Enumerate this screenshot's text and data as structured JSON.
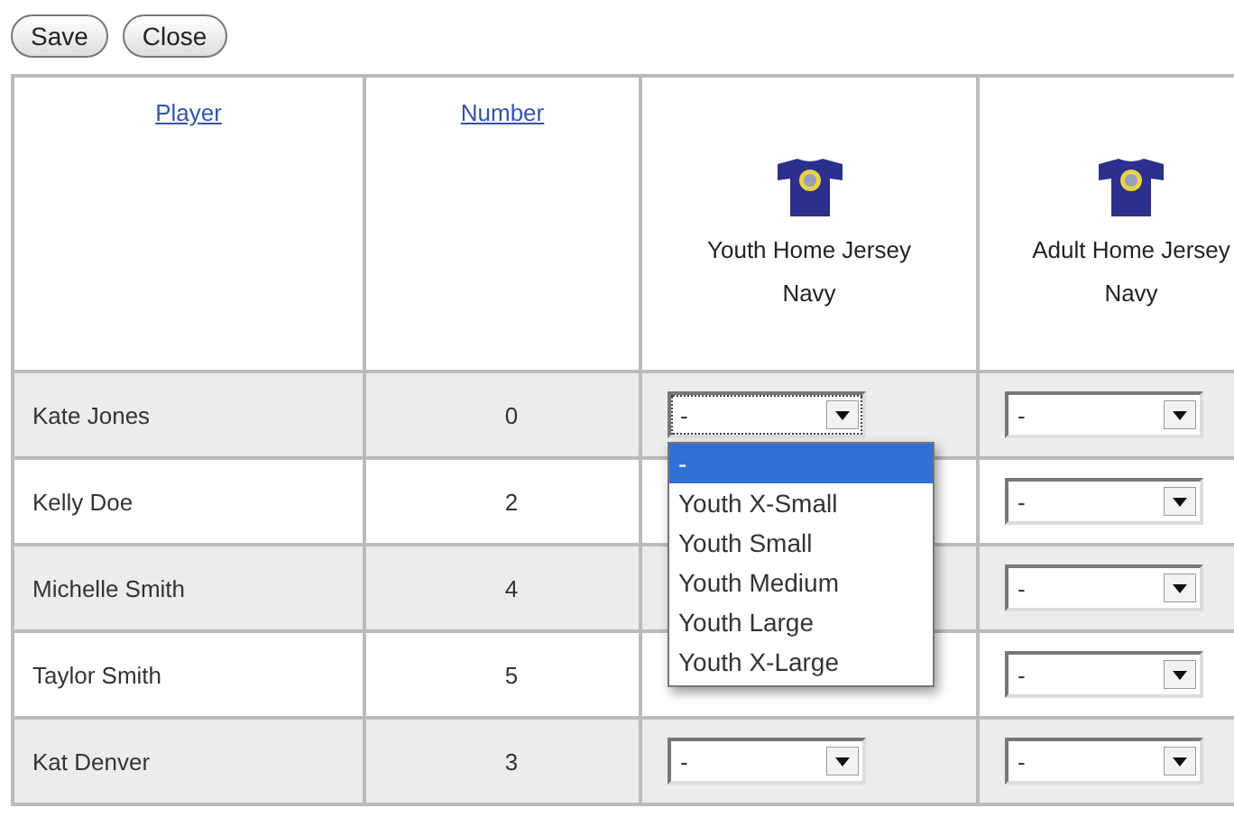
{
  "toolbar": {
    "buttons": [
      "Save",
      "Close"
    ]
  },
  "table": {
    "columns": [
      {
        "kind": "link",
        "label": "Player"
      },
      {
        "kind": "link",
        "label": "Number"
      },
      {
        "kind": "jersey",
        "label": "Youth Home Jersey Navy"
      },
      {
        "kind": "jersey",
        "label": "Adult Home Jersey Navy"
      }
    ],
    "rows": [
      {
        "player": "Kate Jones",
        "number": "0",
        "youth": {
          "value": "-",
          "focused": true,
          "open": true,
          "options": [
            {
              "label": "-",
              "selected": true
            },
            {
              "label": "Youth X-Small",
              "selected": false
            },
            {
              "label": "Youth Small",
              "selected": false
            },
            {
              "label": "Youth Medium",
              "selected": false
            },
            {
              "label": "Youth Large",
              "selected": false
            },
            {
              "label": "Youth X-Large",
              "selected": false
            }
          ]
        },
        "adult": {
          "value": "-",
          "focused": false
        }
      },
      {
        "player": "Kelly Doe",
        "number": "2",
        "adult": {
          "value": "-",
          "focused": false
        }
      },
      {
        "player": "Michelle Smith",
        "number": "4",
        "adult": {
          "value": "-",
          "focused": false
        }
      },
      {
        "player": "Taylor Smith",
        "number": "5",
        "adult": {
          "value": "-",
          "focused": false
        }
      },
      {
        "player": "Kat Denver",
        "number": "3",
        "youth": {
          "value": "-",
          "focused": false
        },
        "adult": {
          "value": "-",
          "focused": false
        }
      }
    ]
  }
}
